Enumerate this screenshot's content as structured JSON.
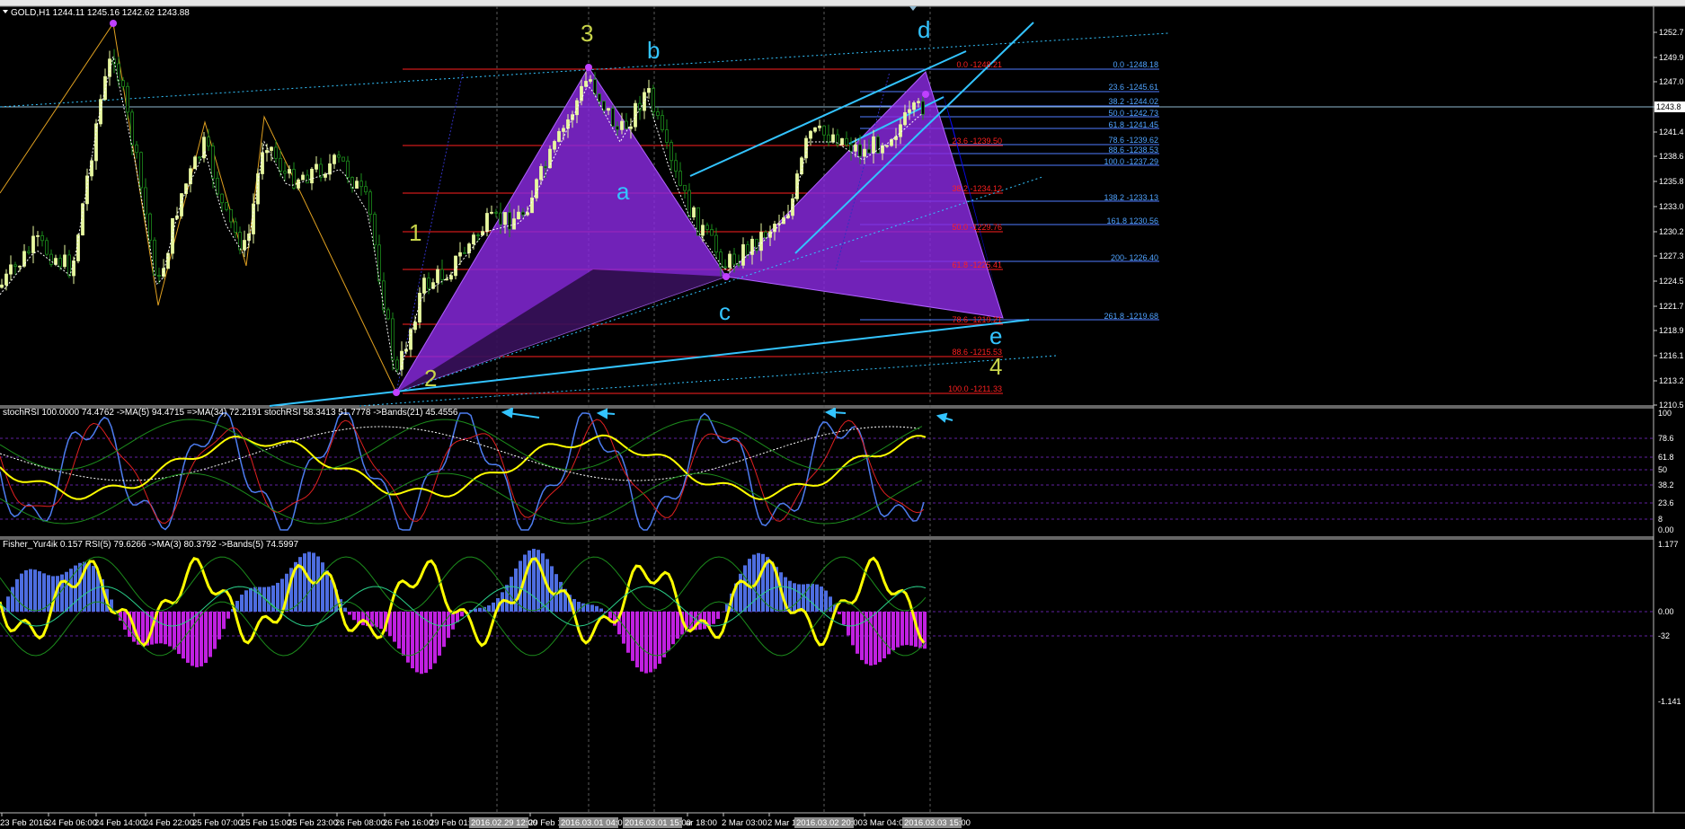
{
  "window": {
    "symbol_header": "GOLD,H1  1244.11 1245.16 1242.62 1243.88",
    "current_price": "1243.8"
  },
  "price_axis": [
    "1252.7",
    "1249.9",
    "1247.0",
    "1244.2",
    "1241.4",
    "1238.6",
    "1235.8",
    "1233.0",
    "1230.2",
    "1227.3",
    "1224.5",
    "1221.7",
    "1218.9",
    "1216.1",
    "1213.2",
    "1210.5"
  ],
  "time_axis": {
    "labels": [
      "23 Feb 2016",
      "24 Feb 06:00",
      "24 Feb 14:00",
      "24 Feb 22:00",
      "25 Feb 07:00",
      "25 Feb 15:00",
      "25 Feb 23:00",
      "26 Feb 08:00",
      "26 Feb 16:00",
      "29 Feb 01:00",
      "29 Feb 17",
      "ar 18:00",
      "2 Mar 03:00",
      "2 Mar 1",
      "3 Mar 04:00"
    ],
    "highlighted": [
      "2016.02.29 12:00",
      "2016.03.01 04:00",
      "2016.03.01 15:00",
      "2016.03.02 20:00",
      "2016.03.03 15:00"
    ]
  },
  "wave_labels": {
    "w1": "1",
    "w2": "2",
    "w3": "3",
    "w4": "4",
    "a": "a",
    "b": "b",
    "c": "c",
    "d": "d",
    "e": "e"
  },
  "fib_red": [
    "0.0 -1248.21",
    "23.6 -1239.50",
    "38.2 -1234.12",
    "50.0 -1229.76",
    "61.8 -1225.41",
    "78.6 -1219.21",
    "88.6 -1215.53",
    "100.0 -1211.33"
  ],
  "fib_blue": [
    "0.0 -1248.18",
    "23.6 -1245.61",
    "38.2 -1244.02",
    "50.0 -1242.73",
    "61.8 -1241.45",
    "78.6 -1239.62",
    "88.6 -1238.53",
    "100.0 -1237.29",
    "138.2 -1233.13",
    "161.8 1230.56",
    "200- 1226.40",
    "261.8 -1219.68"
  ],
  "stoch_panel": {
    "header": "stochRSI 100.0000 74.4762 ->MA(5) 94.4715 =>MA(34) 72.2191  stochRSI 58.3413 51.7778  ->Bands(21) 45.4556",
    "levels": [
      "100",
      "78.6",
      "61.8",
      "50",
      "38.2",
      "23.6",
      "8",
      "0.00"
    ]
  },
  "fisher_panel": {
    "header": "Fisher_Yur4ik 0.157  RSI(5) 79.6266  ->MA(3) 80.3792  ->Bands(5) 74.5997",
    "levels": [
      "1.177",
      "0.00",
      "-32",
      "-1.141"
    ]
  },
  "colors": {
    "background": "#000000",
    "bull_candle": "#e8f8a0",
    "bear_candle": "#1c8c1c",
    "fib_red": "#ff2020",
    "fib_blue": "#4fa3ff",
    "channel": "#00c8ff",
    "pattern_fill": "#8a2ae0",
    "wave_green": "#c8d44a",
    "wave_cyan": "#33c4ff",
    "stoch_yellow": "#ffff00",
    "fisher_hist_pos": "#4d6de0",
    "fisher_hist_neg": "#c020e0"
  }
}
